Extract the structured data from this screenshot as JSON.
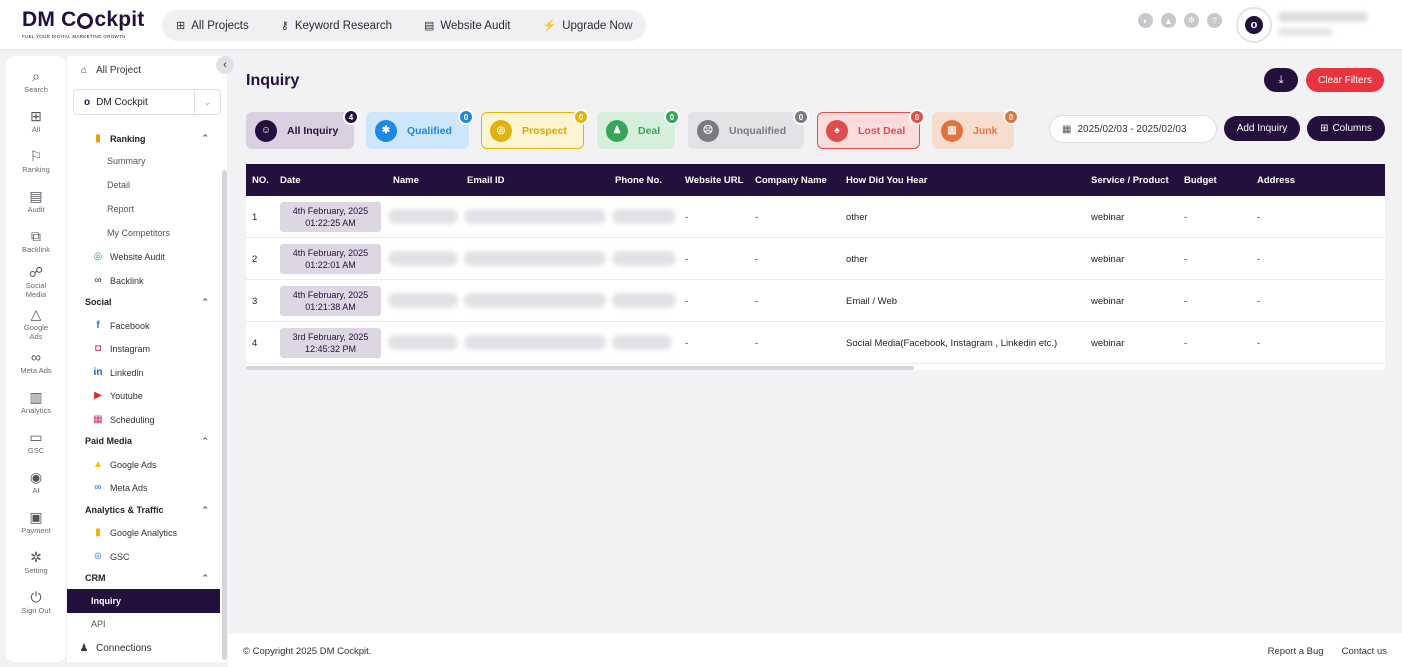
{
  "brand": {
    "name_a": "DM C",
    "name_b": "ckpit",
    "tagline": "FUEL YOUR DIGITAL MARKETING GROWTH"
  },
  "topnav": [
    {
      "icon": "grid-icon",
      "glyph": "⊞",
      "label": "All Projects"
    },
    {
      "icon": "key-icon",
      "glyph": "⚷",
      "label": "Keyword Research"
    },
    {
      "icon": "audit-icon",
      "glyph": "▤",
      "label": "Website Audit"
    },
    {
      "icon": "bolt-icon",
      "glyph": "⚡",
      "label": "Upgrade Now"
    }
  ],
  "rail": [
    {
      "label": "Search",
      "glyph": "⌕"
    },
    {
      "label": "All",
      "glyph": "⊞"
    },
    {
      "label": "Ranking",
      "glyph": "⚐"
    },
    {
      "label": "Audit",
      "glyph": "▤"
    },
    {
      "label": "Backlink",
      "glyph": "⧉"
    },
    {
      "label": "Social",
      "label2": "Media",
      "glyph": "☍"
    },
    {
      "label": "Google",
      "label2": "Ads",
      "glyph": "△"
    },
    {
      "label": "Meta Ads",
      "glyph": "∞"
    },
    {
      "label": "Analytics",
      "glyph": "▥"
    },
    {
      "label": "GSC",
      "glyph": "▭"
    },
    {
      "label": "AI",
      "glyph": "◉"
    },
    {
      "label": "Payment",
      "glyph": "▣"
    },
    {
      "label": "Setting",
      "glyph": "✲"
    },
    {
      "label": "Sign Out",
      "glyph": "⏻"
    }
  ],
  "sidebar": {
    "all_project": "All Project",
    "project_select": "DM Cockpit",
    "ranking": "Ranking",
    "ranking_items": [
      "Summary",
      "Detail",
      "Report",
      "My Competitors"
    ],
    "website_audit": "Website Audit",
    "backlink": "Backlink",
    "social": "Social",
    "social_items": [
      "Facebook",
      "Instagram",
      "Linkedin",
      "Youtube",
      "Scheduling"
    ],
    "paid_media": "Paid Media",
    "paid_items": [
      "Google Ads",
      "Meta Ads"
    ],
    "analytics": "Analytics & Traffic",
    "analytics_items": [
      "Google Analytics",
      "GSC"
    ],
    "crm": "CRM",
    "crm_items": [
      "Inquiry",
      "API"
    ],
    "connections": "Connections"
  },
  "page": {
    "title": "Inquiry",
    "clear_filters": "Clear Filters",
    "date_range": "2025/02/03 - 2025/02/03",
    "add_inquiry": "Add Inquiry",
    "columns": "Columns"
  },
  "tabs": [
    {
      "label": "All Inquiry",
      "count": "4",
      "bg": "#d9d1e1",
      "fg": "#24103d",
      "icon_bg": "#24103d",
      "badge_bg": "#24103d",
      "border": "#d9d1e1"
    },
    {
      "label": "Qualified",
      "count": "0",
      "bg": "#cde6fb",
      "fg": "#1e88e5",
      "icon_bg": "#1e88e5",
      "badge_bg": "#1e88e5",
      "border": "#cde6fb"
    },
    {
      "label": "Prospect",
      "count": "0",
      "bg": "#fdf5d1",
      "fg": "#d4a800",
      "icon_bg": "#e3b20f",
      "badge_bg": "#e3b20f",
      "border": "#e3b20f"
    },
    {
      "label": "Deal",
      "count": "0",
      "bg": "#d6efdc",
      "fg": "#36a75a",
      "icon_bg": "#36a75a",
      "badge_bg": "#36a75a",
      "border": "#d6efdc"
    },
    {
      "label": "Unqualified",
      "count": "0",
      "bg": "#e3e3e5",
      "fg": "#7a7a80",
      "icon_bg": "#7a7a80",
      "badge_bg": "#7a7a80",
      "border": "#e3e3e5"
    },
    {
      "label": "Lost Deal",
      "count": "0",
      "bg": "#fbdcdc",
      "fg": "#e14c4c",
      "icon_bg": "#e14c4c",
      "badge_bg": "#e14c4c",
      "border": "#e14c4c"
    },
    {
      "label": "Junk",
      "count": "0",
      "bg": "#f7ddcf",
      "fg": "#e2733c",
      "icon_bg": "#e2733c",
      "badge_bg": "#e2733c",
      "border": "#f7ddcf"
    }
  ],
  "table": {
    "headers": [
      "NO.",
      "Date",
      "Name",
      "Email ID",
      "Phone No.",
      "Website URL",
      "Company Name",
      "How Did You Hear",
      "Service / Product",
      "Budget",
      "Address"
    ],
    "rows": [
      {
        "no": "1",
        "date1": "4th February, 2025",
        "date2": "01:22:25 AM",
        "url": "-",
        "company": "-",
        "heard": "other",
        "service": "webinar",
        "budget": "-",
        "address": "-"
      },
      {
        "no": "2",
        "date1": "4th February, 2025",
        "date2": "01:22:01 AM",
        "url": "-",
        "company": "-",
        "heard": "other",
        "service": "webinar",
        "budget": "-",
        "address": "-"
      },
      {
        "no": "3",
        "date1": "4th February, 2025",
        "date2": "01:21:38 AM",
        "url": "-",
        "company": "-",
        "heard": "Email / Web",
        "service": "webinar",
        "budget": "-",
        "address": "-"
      },
      {
        "no": "4",
        "date1": "3rd February, 2025",
        "date2": "12:45:32 PM",
        "url": "-",
        "company": "-",
        "heard": "Social Media(Facebook, Instagram , Linkedin etc.)",
        "service": "webinar",
        "budget": "-",
        "address": "-"
      }
    ]
  },
  "footer": {
    "copyright": "© Copyright 2025 DM Cockpit.",
    "report_bug": "Report a Bug",
    "contact": "Contact us"
  }
}
